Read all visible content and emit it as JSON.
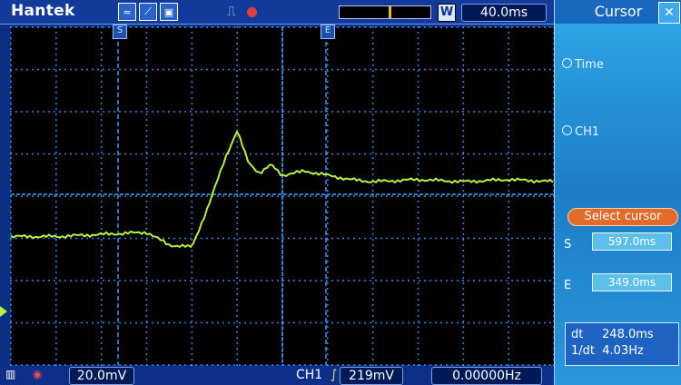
{
  "header": {
    "brand": "Hantek",
    "timebase": "40.0ms",
    "w_label": "W"
  },
  "panel": {
    "title": "Cursor",
    "close_icon": "close-icon",
    "option_time": "Time",
    "option_ch1": "CH1",
    "select_cursor": "Select cursor",
    "s_label": "S",
    "s_value": "597.0ms",
    "e_label": "E",
    "e_value": "349.0ms",
    "dt_label": "dt",
    "dt_value": "248.0ms",
    "inv_label": "1/dt",
    "inv_value": "4.03Hz"
  },
  "footer": {
    "ch_scale": "20.0mV",
    "ch_label": "CH1",
    "trigger_level": "219mV",
    "frequency": "0.00000Hz"
  },
  "markers": {
    "cursor_s": "S",
    "cursor_e": "E"
  },
  "colors": {
    "screen": "#0a2f85",
    "grid": "#3fa0ff",
    "trace": "#b8f040",
    "panel": "#2a96dc"
  },
  "chart_data": {
    "type": "line",
    "x_units": "ms",
    "y_units": "mV",
    "time_per_div_ms": 40,
    "volts_per_div_mV": 20,
    "signal": "step response with overshoot and ringing",
    "x": [
      0,
      40,
      80,
      120,
      140,
      160,
      175,
      190,
      200,
      210,
      220,
      230,
      240,
      260,
      280,
      300,
      320,
      360,
      400,
      440,
      480
    ],
    "y": [
      -20,
      -20,
      -19,
      -18,
      -24,
      -25,
      -5,
      18,
      30,
      15,
      10,
      14,
      9,
      11,
      9,
      7,
      6,
      7,
      6,
      7,
      6
    ]
  }
}
